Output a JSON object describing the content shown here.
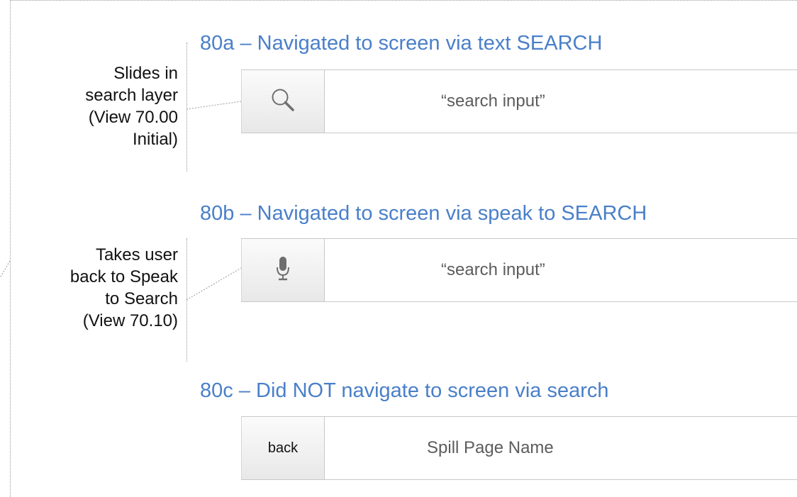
{
  "sections": [
    {
      "title": "80a – Navigated to screen via text SEARCH",
      "button_icon": "search-icon",
      "input_text": "“search input”",
      "note": [
        "Slides in",
        "search layer",
        "(View 70.00",
        "Initial)"
      ]
    },
    {
      "title": "80b – Navigated to screen via speak to SEARCH",
      "button_icon": "microphone-icon",
      "input_text": "“search input”",
      "note": [
        "Takes user",
        "back to Speak",
        "to Search",
        "(View 70.10)"
      ]
    },
    {
      "title": "80c – Did NOT navigate to screen via search",
      "button_label": "back",
      "page_name": "Spill Page Name"
    }
  ],
  "colors": {
    "title": "#4a7fc9",
    "border": "#c8c8c8",
    "button_gradient_top": "#fbfbfb",
    "button_gradient_bottom": "#e8e8e8"
  }
}
